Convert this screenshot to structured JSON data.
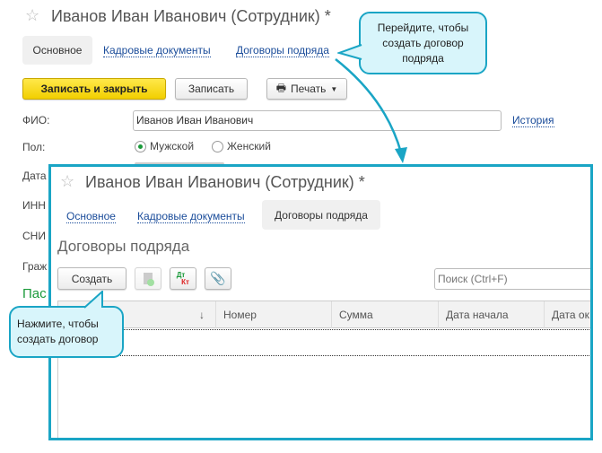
{
  "back_form": {
    "title": "Иванов Иван Иванович (Сотрудник) *",
    "tabs": [
      "Основное",
      "Кадровые документы",
      "Договоры подряда"
    ],
    "buttons": {
      "save_close": "Записать и закрыть",
      "save": "Записать",
      "print": "Печать"
    },
    "fio_label": "ФИО:",
    "fio_value": "Иванов Иван Иванович",
    "history": "История",
    "gender_label": "Пол:",
    "gender_options": [
      "Мужской",
      "Женский"
    ],
    "gender_selected": "Мужской",
    "partial_labels": [
      "Дата",
      "ИНН",
      "СНИ",
      "Граж",
      "Пас"
    ]
  },
  "front_form": {
    "title": "Иванов Иван Иванович (Сотрудник) *",
    "tabs": [
      "Основное",
      "Кадровые документы",
      "Договоры подряда"
    ],
    "active_tab": "Договоры подряда",
    "heading": "Договоры подряда",
    "create_button": "Создать",
    "dtkt_icon": {
      "dt": "Дт",
      "kt": "Кт"
    },
    "search_placeholder": "Поиск (Ctrl+F)",
    "columns": [
      "↓",
      "Номер",
      "Сумма",
      "Дата начала",
      "Дата ок"
    ]
  },
  "callouts": {
    "tab_hint": "Перейдите, чтобы создать договор подряда",
    "create_hint": "Нажмите, чтобы создать договор"
  },
  "colors": {
    "accent": "#1aa5c5",
    "callout_bg": "#d8f5fb",
    "primary_button": "#f2cf00",
    "link": "#1a4c9a",
    "section_green": "#1a9a3a"
  }
}
